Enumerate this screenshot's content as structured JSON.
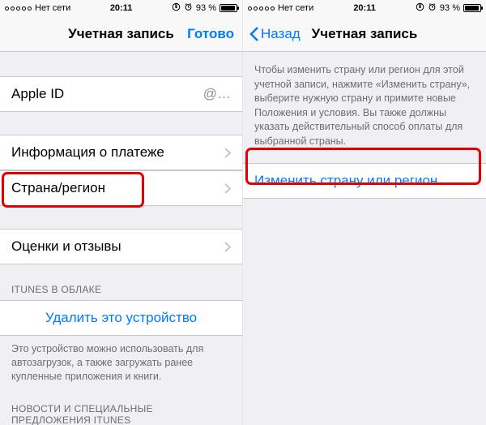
{
  "status": {
    "carrier": "Нет сети",
    "time": "20:11",
    "battery_pct": "93 %"
  },
  "left": {
    "nav_title": "Учетная запись",
    "done": "Готово",
    "rows": {
      "apple_id_label": "Apple ID",
      "apple_id_value": "@…",
      "payment_info": "Информация о платеже",
      "country_region": "Страна/регион",
      "ratings_reviews": "Оценки и отзывы"
    },
    "cloud_header": "iTUNES В ОБЛАКЕ",
    "remove_device": "Удалить это устройство",
    "remove_device_note": "Это устройство можно использовать для автозагрузок, а также загружать ранее купленные приложения и книги.",
    "news_header": "НОВОСТИ И СПЕЦИАЛЬНЫЕ ПРЕДЛОЖЕНИЯ iTUNES"
  },
  "right": {
    "back": "Назад",
    "nav_title": "Учетная запись",
    "help_text": "Чтобы изменить страну или регион для этой учетной записи, нажмите «Изменить страну», выберите нужную страну и примите новые Положения и условия. Вы также должны указать действительный способ оплаты для выбранной страны.",
    "change_country": "Изменить страну или регион"
  }
}
